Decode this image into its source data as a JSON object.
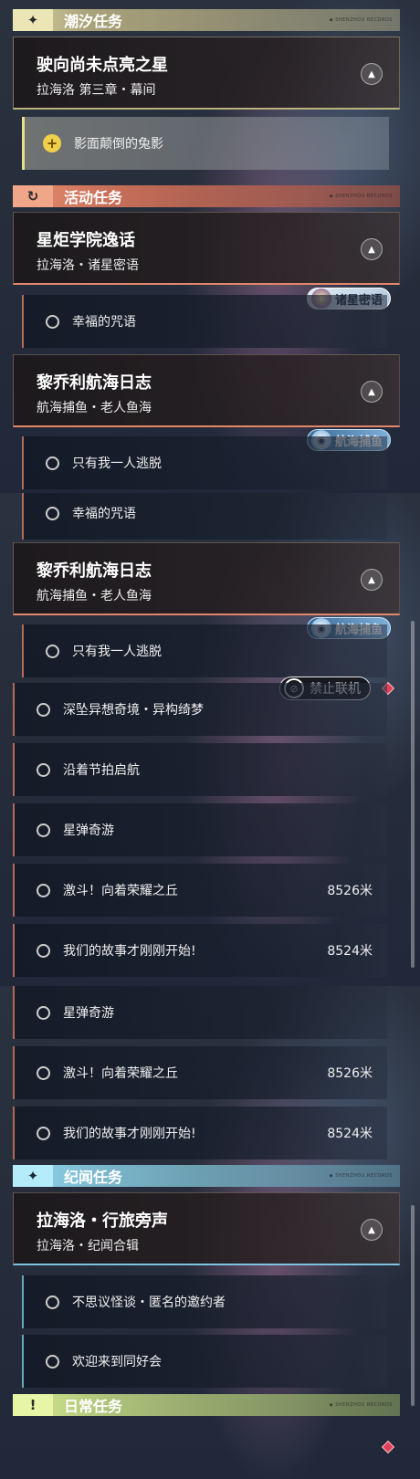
{
  "panel1": {
    "tide_header": {
      "title": "潮汐任务",
      "icon": "✦",
      "deco": "◆ SHENZHOU RECORDS"
    },
    "tide_quest": {
      "title": "驶向尚未点亮之星",
      "subtitle": "拉海洛 第三章・幕间",
      "toggle": "▲"
    },
    "tide_task": {
      "label": "影面颠倒的兔影",
      "icon": "+"
    },
    "event_header": {
      "title": "活动任务",
      "icon": "↻",
      "deco": "◆ SHENZHOU RECORDS"
    },
    "event_quest_1": {
      "title": "星炬学院逸话",
      "subtitle": "拉海洛・诸星密语",
      "toggle": "▲"
    },
    "tag_stars": {
      "label": "诸星密语",
      "icon": "✧"
    },
    "task_1": {
      "label": "幸福的咒语"
    },
    "event_quest_2": {
      "title": "黎乔利航海日志",
      "subtitle": "航海捕鱼・老人鱼海",
      "toggle": "▲"
    },
    "tag_fish": {
      "label": "航海捕鱼",
      "icon": "◉"
    },
    "task_2": {
      "label": "只有我一人逃脱"
    }
  },
  "panel2": {
    "task_1": {
      "label": "幸福的咒语"
    },
    "event_quest_2": {
      "title": "黎乔利航海日志",
      "subtitle": "航海捕鱼・老人鱼海",
      "toggle": "▲"
    },
    "tag_fish": {
      "label": "航海捕鱼",
      "icon": "◉"
    },
    "task_2": {
      "label": "只有我一人逃脱"
    },
    "ban_badge": {
      "label": "禁止联机",
      "icon": "⊘"
    },
    "task_3": {
      "label": "深坠异想奇境・异构绮梦"
    },
    "task_4": {
      "label": "沿着节拍启航"
    },
    "task_5": {
      "label": "星弹奇游"
    },
    "task_6": {
      "label": "激斗！向着荣耀之丘",
      "distance": "8526米"
    },
    "task_7": {
      "label": "我们的故事才刚刚开始!",
      "distance": "8524米"
    }
  },
  "panel3": {
    "task_5": {
      "label": "星弹奇游"
    },
    "task_6": {
      "label": "激斗！向着荣耀之丘",
      "distance": "8526米"
    },
    "task_7": {
      "label": "我们的故事才刚刚开始!",
      "distance": "8524米"
    },
    "chron_header": {
      "title": "纪闻任务",
      "icon": "✦",
      "deco": "◆ SHENZHOU RECORDS"
    },
    "chron_quest": {
      "title": "拉海洛・行旅旁声",
      "subtitle": "拉海洛・纪闻合辑",
      "toggle": "▲"
    },
    "chron_task_1": {
      "label": "不思议怪谈・匿名的邀约者"
    },
    "chron_task_2": {
      "label": "欢迎来到同好会"
    },
    "daily_header": {
      "title": "日常任务",
      "icon": "!",
      "deco": "◆ SHENZHOU RECORDS"
    }
  },
  "colors": {
    "tide": "#d9d3a2",
    "event": "#e98f6f",
    "chron": "#8fd7ee",
    "daily": "#d7ea8e",
    "ban_diamond": "#e0405a"
  }
}
